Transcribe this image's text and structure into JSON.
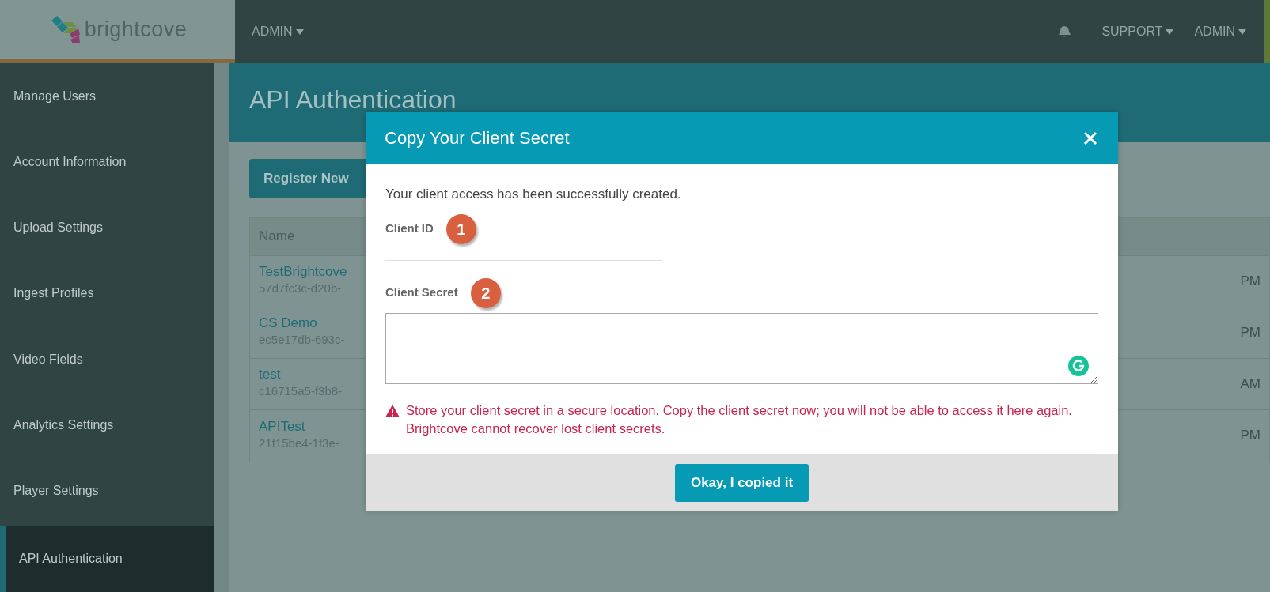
{
  "header": {
    "logo_text": "brightcove",
    "nav": [
      {
        "label": "ADMIN"
      }
    ],
    "right_nav": [
      {
        "label": "SUPPORT"
      },
      {
        "label": "ADMIN"
      }
    ]
  },
  "sidebar": {
    "items": [
      {
        "label": "Manage Users",
        "selected": false
      },
      {
        "label": "Account Information",
        "selected": false
      },
      {
        "label": "Upload Settings",
        "selected": false
      },
      {
        "label": "Ingest Profiles",
        "selected": false
      },
      {
        "label": "Video Fields",
        "selected": false
      },
      {
        "label": "Analytics Settings",
        "selected": false
      },
      {
        "label": "Player Settings",
        "selected": false
      },
      {
        "label": "API Authentication",
        "selected": true
      }
    ]
  },
  "page": {
    "title": "API Authentication",
    "register_button": "Register New",
    "table": {
      "columns": [
        "Name"
      ],
      "rows": [
        {
          "name": "TestBrightcove",
          "id": "57d7fc3c-d20b-",
          "column_3": "PM"
        },
        {
          "name": "CS Demo",
          "id": "ec5e17db-693c-",
          "column_3": "PM"
        },
        {
          "name": "test",
          "id": "c16715a5-f3b8-",
          "column_3": "AM"
        },
        {
          "name": "APITest",
          "id": "21f15be4-1f3e-",
          "column_3": "PM"
        }
      ]
    }
  },
  "modal": {
    "title": "Copy Your Client Secret",
    "message": "Your client access has been successfully created.",
    "fields": [
      {
        "label": "Client ID",
        "step": "1",
        "kind": "line"
      },
      {
        "label": "Client Secret",
        "step": "2",
        "kind": "textarea"
      }
    ],
    "warning": "Store your client secret in a secure location. Copy the client secret now; you will not be able to access it here again. Brightcove cannot recover lost client secrets.",
    "button": "Okay, I copied it"
  }
}
